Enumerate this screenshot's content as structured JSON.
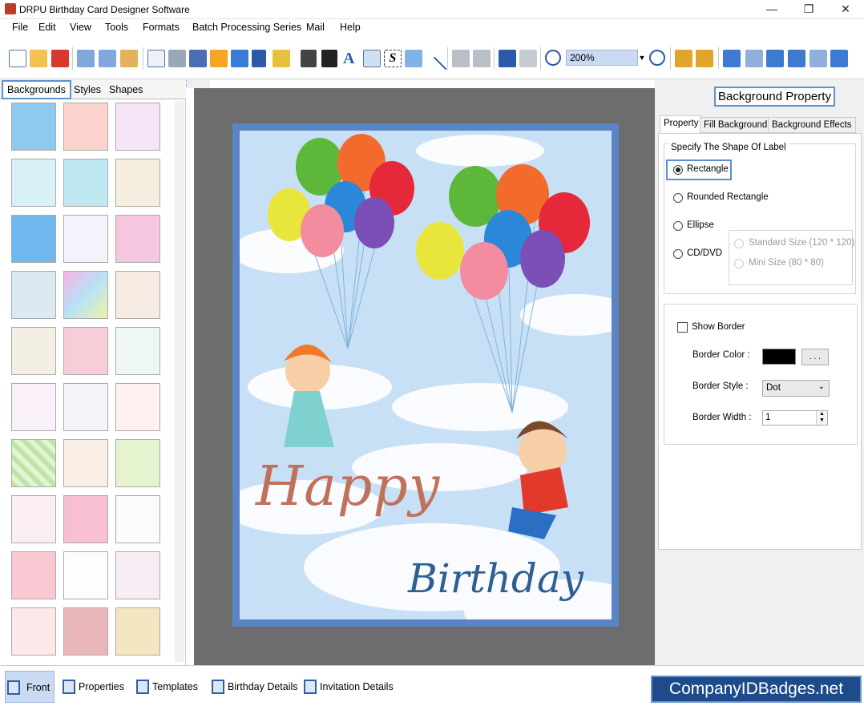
{
  "window": {
    "title": "DRPU Birthday Card Designer Software",
    "minimize": "—",
    "maximize": "❐",
    "close": "✕"
  },
  "menu": [
    "File",
    "Edit",
    "View",
    "Tools",
    "Formats",
    "Batch Processing Series",
    "Mail",
    "Help"
  ],
  "toolbar": {
    "zoom_value": "200%"
  },
  "left_tabs": [
    "Backgrounds",
    "Styles",
    "Shapes"
  ],
  "card": {
    "line1": "Happy",
    "line2": "Birthday"
  },
  "right": {
    "header": "Background Property",
    "tabs": [
      "Property",
      "Fill Background",
      "Background Effects"
    ],
    "shape_group_label": "Specify The Shape Of Label",
    "shapes": [
      "Rectangle",
      "Rounded Rectangle",
      "Ellipse",
      "CD/DVD"
    ],
    "cd_sizes": [
      "Standard Size (120 * 120)",
      "Mini Size (80 * 80)"
    ],
    "show_border": "Show Border",
    "border_color_label": "Border Color :",
    "browse": ". . .",
    "border_style_label": "Border Style :",
    "border_style_value": "Dot",
    "border_width_label": "Border Width :",
    "border_width_value": "1"
  },
  "bottom_tabs": [
    "Front",
    "Properties",
    "Templates",
    "Birthday Details",
    "Invitation Details"
  ],
  "brand": "CompanyIDBadges.net"
}
